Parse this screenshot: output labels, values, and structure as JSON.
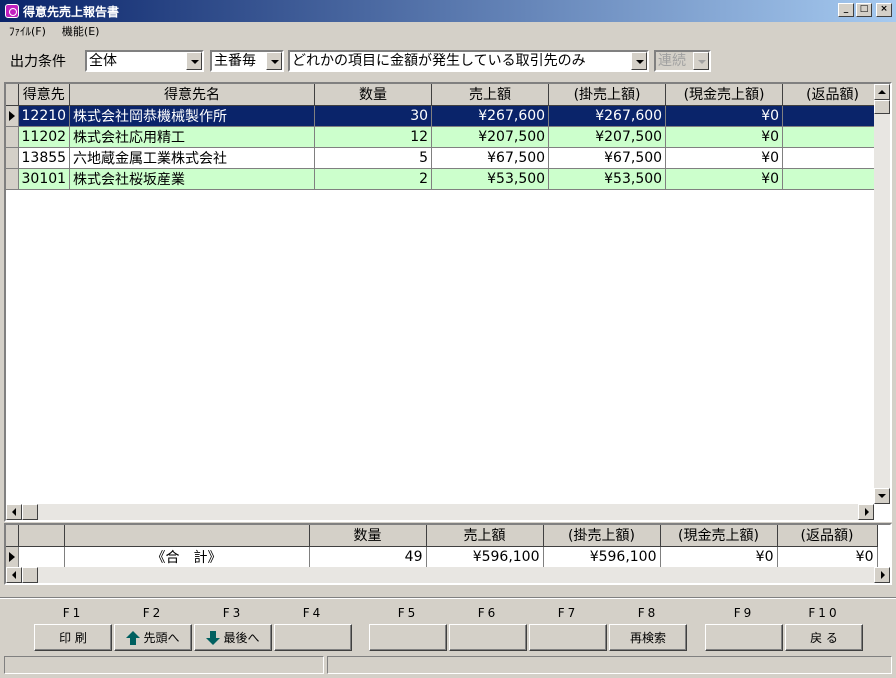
{
  "window": {
    "title": "得意先売上報告書"
  },
  "menu": [
    {
      "label": "ﾌｧｲﾙ(F)"
    },
    {
      "label": "機能(E)"
    }
  ],
  "conditions": {
    "label": "出力条件",
    "scope": "全体",
    "grouping": "主番毎",
    "filter": "どれかの項目に金額が発生している取引先のみ",
    "mode": "連続"
  },
  "grid": {
    "headers": [
      "得意先",
      "得意先名",
      "数量",
      "売上額",
      "(掛売上額)",
      "(現金売上額)",
      "(返品額)"
    ],
    "rows": [
      {
        "code": "12210",
        "name": "株式会社岡恭機械製作所",
        "qty": "30",
        "sales": "¥267,600",
        "credit": "¥267,600",
        "cash": "¥0",
        "returns": "",
        "state": "selected"
      },
      {
        "code": "11202",
        "name": "株式会社応用精工",
        "qty": "12",
        "sales": "¥207,500",
        "credit": "¥207,500",
        "cash": "¥0",
        "returns": "",
        "state": "green"
      },
      {
        "code": "13855",
        "name": "六地蔵金属工業株式会社",
        "qty": "5",
        "sales": "¥67,500",
        "credit": "¥67,500",
        "cash": "¥0",
        "returns": "",
        "state": "normal"
      },
      {
        "code": "30101",
        "name": "株式会社桜坂産業",
        "qty": "2",
        "sales": "¥53,500",
        "credit": "¥53,500",
        "cash": "¥0",
        "returns": "",
        "state": "green"
      }
    ]
  },
  "totals": {
    "headers": [
      "",
      "",
      "数量",
      "売上額",
      "(掛売上額)",
      "(現金売上額)",
      "(返品額)"
    ],
    "label": "《合　計》",
    "qty": "49",
    "sales": "¥596,100",
    "credit": "¥596,100",
    "cash": "¥0",
    "returns": "¥0"
  },
  "fkeys": [
    {
      "key": "F1",
      "label": "印 刷",
      "icon": ""
    },
    {
      "key": "F2",
      "label": "先頭へ",
      "icon": "arrow-up-icon"
    },
    {
      "key": "F3",
      "label": "最後へ",
      "icon": "arrow-down-icon"
    },
    {
      "key": "F4",
      "label": "",
      "icon": ""
    },
    {
      "key": "F5",
      "label": "",
      "icon": ""
    },
    {
      "key": "F6",
      "label": "",
      "icon": ""
    },
    {
      "key": "F7",
      "label": "",
      "icon": ""
    },
    {
      "key": "F8",
      "label": "再検索",
      "icon": ""
    },
    {
      "key": "F9",
      "label": "",
      "icon": ""
    },
    {
      "key": "F10",
      "label": "戻 る",
      "icon": ""
    }
  ],
  "status": {
    "left": "",
    "right": ""
  }
}
